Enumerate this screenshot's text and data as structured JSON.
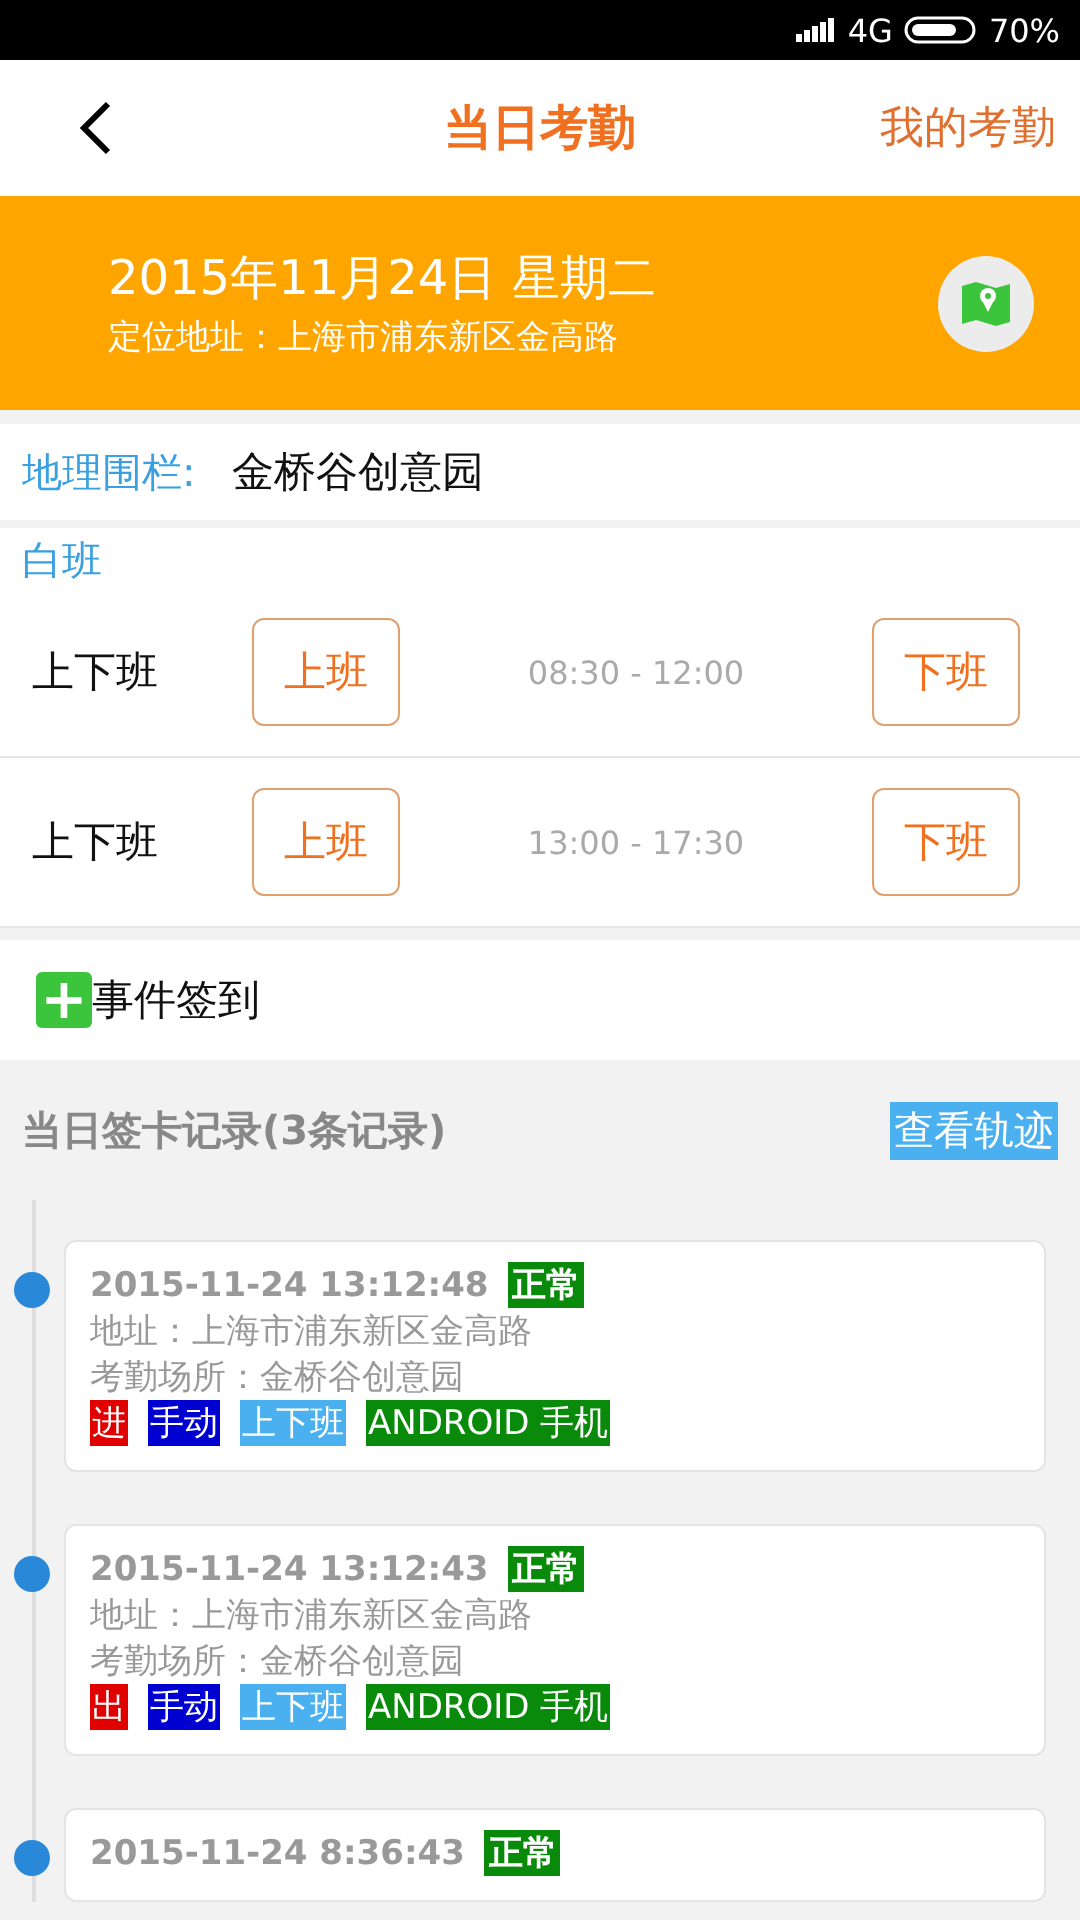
{
  "status_bar": {
    "network": "4G",
    "battery": "70%"
  },
  "header": {
    "title": "当日考勤",
    "action": "我的考勤"
  },
  "banner": {
    "date": "2015年11月24日 星期二",
    "location": "定位地址：上海市浦东新区金高路"
  },
  "geofence": {
    "label": "地理围栏:",
    "value": "金桥谷创意园"
  },
  "shift": {
    "name": "白班",
    "rows": [
      {
        "label": "上下班",
        "check_in": "上班",
        "time": "08:30 - 12:00",
        "check_out": "下班"
      },
      {
        "label": "上下班",
        "check_in": "上班",
        "time": "13:00 - 17:30",
        "check_out": "下班"
      }
    ]
  },
  "event_checkin": {
    "icon": "+",
    "label": "事件签到"
  },
  "records_header": {
    "title": "当日签卡记录(3条记录)",
    "track_button": "查看轨迹"
  },
  "records": [
    {
      "time": "2015-11-24 13:12:48",
      "status": "正常",
      "address": "地址：上海市浦东新区金高路",
      "place": "考勤场所：金桥谷创意园",
      "tags": [
        {
          "text": "进",
          "color": "#e00000"
        },
        {
          "text": "手动",
          "color": "#0000d0"
        },
        {
          "text": "上下班",
          "color": "#4ab0f0"
        },
        {
          "text": "ANDROID 手机",
          "color": "#0a8a0a"
        }
      ]
    },
    {
      "time": "2015-11-24 13:12:43",
      "status": "正常",
      "address": "地址：上海市浦东新区金高路",
      "place": "考勤场所：金桥谷创意园",
      "tags": [
        {
          "text": "出",
          "color": "#e00000"
        },
        {
          "text": "手动",
          "color": "#0000d0"
        },
        {
          "text": "上下班",
          "color": "#4ab0f0"
        },
        {
          "text": "ANDROID 手机",
          "color": "#0a8a0a"
        }
      ]
    },
    {
      "time": "2015-11-24 8:36:43",
      "status": "正常"
    }
  ]
}
